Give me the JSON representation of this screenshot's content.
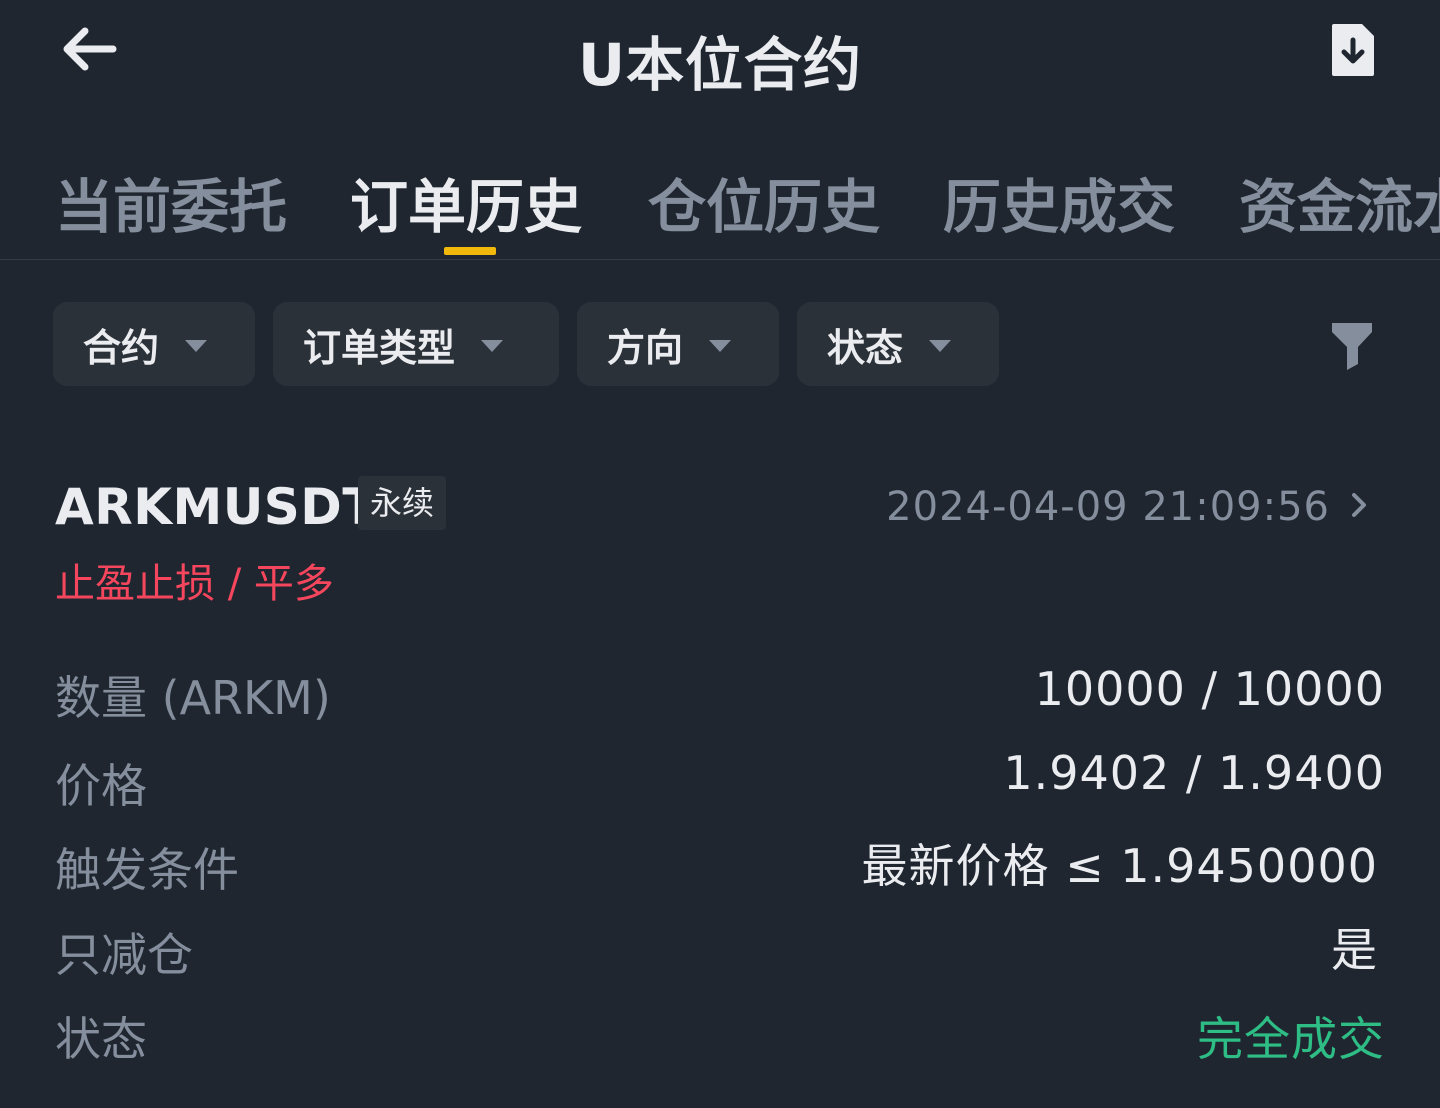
{
  "header": {
    "title": "U本位合约",
    "back_icon": "arrow-left-icon",
    "download_icon": "download-document-icon"
  },
  "tabs": [
    {
      "label": "当前委托",
      "active": false
    },
    {
      "label": "订单历史",
      "active": true
    },
    {
      "label": "仓位历史",
      "active": false
    },
    {
      "label": "历史成交",
      "active": false
    },
    {
      "label": "资金流水",
      "active": false
    }
  ],
  "filters": [
    {
      "label": "合约"
    },
    {
      "label": "订单类型"
    },
    {
      "label": "方向"
    },
    {
      "label": "状态"
    }
  ],
  "filter_icon": "funnel-icon",
  "order": {
    "symbol": "ARKMUSDT",
    "contract_badge": "永续",
    "timestamp": "2024-04-09 21:09:56",
    "type": "止盈止损 / 平多",
    "rows": [
      {
        "label": "数量 (ARKM)",
        "value": "10000 / 10000"
      },
      {
        "label": "价格",
        "value": "1.9402 / 1.9400"
      },
      {
        "label": "触发条件",
        "value": "最新价格 ≤ 1.9450000"
      },
      {
        "label": "只减仓",
        "value": "是"
      },
      {
        "label": "状态",
        "value": "完全成交"
      }
    ]
  },
  "colors": {
    "background": "#1f2630",
    "accent": "#f0b90b",
    "sell_red": "#f6465d",
    "filled_green": "#2ebd85",
    "muted_text": "#848e9c"
  }
}
